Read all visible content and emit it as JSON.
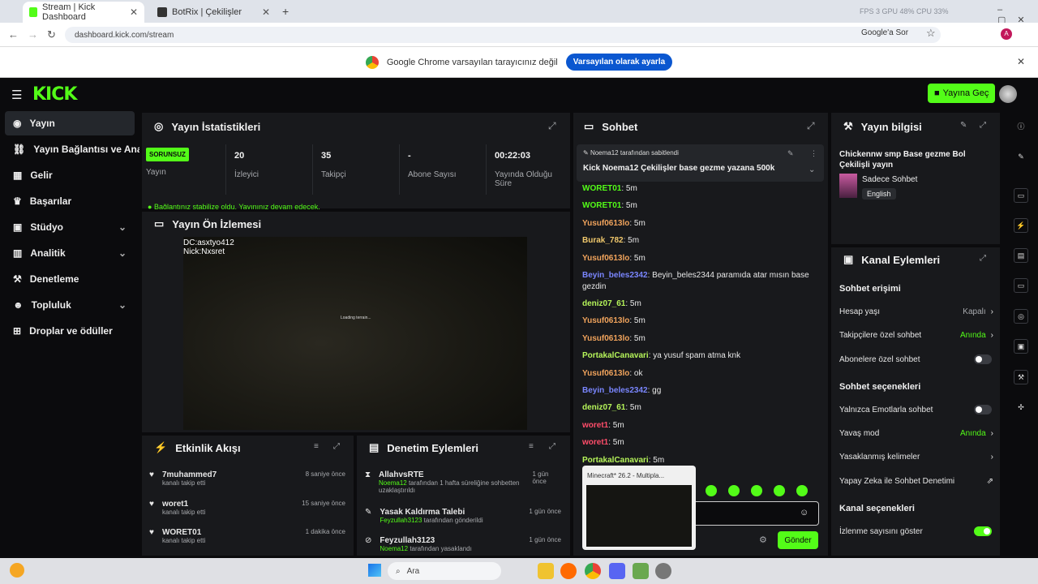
{
  "browser": {
    "tabs": [
      {
        "label": "Stream | Kick Dashboard"
      },
      {
        "label": "BotRix | Çekilişler"
      }
    ],
    "sysinfo": "FPS 3   GPU 48%   CPU 33%",
    "url": "dashboard.kick.com/stream",
    "google_lens_label": "Google'a Sor",
    "default_browser_msg": "Google Chrome varsayılan tarayıcınız değil",
    "default_browser_btn": "Varsayılan olarak ayarla"
  },
  "kick": {
    "logo": "KICK",
    "golive": "Yayına Geç"
  },
  "sidebar": {
    "items": [
      {
        "label": "Yayın",
        "icon": "broadcast-icon"
      },
      {
        "label": "Yayın Bağlantısı ve Anahtarı",
        "icon": "link-icon"
      },
      {
        "label": "Gelir",
        "icon": "money-icon"
      },
      {
        "label": "Başarılar",
        "icon": "trophy-icon"
      },
      {
        "label": "Stüdyo",
        "icon": "studio-icon"
      },
      {
        "label": "Analitik",
        "icon": "chart-icon"
      },
      {
        "label": "Denetleme",
        "icon": "hammer-icon"
      },
      {
        "label": "Topluluk",
        "icon": "community-icon"
      },
      {
        "label": "Droplar ve ödüller",
        "icon": "gift-icon"
      }
    ]
  },
  "stats": {
    "title": "Yayın İstatistikleri",
    "status_badge": "SORUNSUZ",
    "status_label": "Yayın",
    "cells": [
      {
        "value": "20",
        "label": "İzleyici"
      },
      {
        "value": "35",
        "label": "Takipçi"
      },
      {
        "value": "-",
        "label": "Abone Sayısı"
      },
      {
        "value": "00:22:03",
        "label": "Yayında Olduğu Süre"
      }
    ],
    "notice": "Bağlantınız stabilize oldu. Yayınınız devam edecek."
  },
  "preview": {
    "title": "Yayın Ön İzlemesi",
    "overlay_line1": "DC:asxtyo412",
    "overlay_line2": "Nick:Nxsret",
    "loading": "Loading terrain..."
  },
  "activity": {
    "title": "Etkinlik Akışı",
    "items": [
      {
        "user": "7muhammed7",
        "action": "kanalı takip etti",
        "time": "8 saniye önce"
      },
      {
        "user": "woret1",
        "action": "kanalı takip etti",
        "time": "15 saniye önce"
      },
      {
        "user": "WORET01",
        "action": "kanalı takip etti",
        "time": "1 dakika önce"
      }
    ]
  },
  "moderation": {
    "title": "Denetim Eylemleri",
    "items": [
      {
        "title": "AllahvsRTE",
        "by": "Noema12",
        "detail": "tarafından 1 hafta süreliğine sohbetten uzaklaştırıldı",
        "time": "1 gün önce"
      },
      {
        "title": "Yasak Kaldırma Talebi",
        "by": "Feyzullah3123",
        "detail": "tarafından gönderildi",
        "time": "1 gün önce"
      },
      {
        "title": "Feyzullah3123",
        "by": "Noema12",
        "detail": "tarafından yasaklandı",
        "time": "1 gün önce"
      }
    ]
  },
  "chat": {
    "title": "Sohbet",
    "pinned_by": "Noema12 tarafından sabitlendi",
    "pinned_msg": "Kick Noema12 Çekilişler base gezme yazana 500k",
    "messages": [
      {
        "user": "WORET01",
        "text": ": 5m",
        "color": "#53fc18"
      },
      {
        "user": "WORET01",
        "text": ": 5m",
        "color": "#53fc18"
      },
      {
        "user": "Yusuf0613lo",
        "text": ": 5m",
        "color": "#f0a35c"
      },
      {
        "user": "Burak_782",
        "text": ": 5m",
        "color": "#f0c86c"
      },
      {
        "user": "Yusuf0613lo",
        "text": ": 5m",
        "color": "#f0a35c"
      },
      {
        "user": "Beyin_beles2342",
        "text": ": Beyin_beles2344 paramıda atar mısın base gezdin",
        "color": "#7a86ff"
      },
      {
        "user": "deniz07_61",
        "text": ": 5m",
        "color": "#b6f55a"
      },
      {
        "user": "Yusuf0613lo",
        "text": ": 5m",
        "color": "#f0a35c"
      },
      {
        "user": "Yusuf0613lo",
        "text": ": 5m",
        "color": "#f0a35c"
      },
      {
        "user": "PortakalCanavari",
        "text": ": ya yusuf spam atma knk",
        "color": "#b6f55a"
      },
      {
        "user": "Yusuf0613lo",
        "text": ": ok",
        "color": "#f0a35c"
      },
      {
        "user": "Beyin_beles2342",
        "text": ": gg",
        "color": "#7a86ff"
      },
      {
        "user": "deniz07_61",
        "text": ": 5m",
        "color": "#b6f55a"
      },
      {
        "user": "woret1",
        "text": ": 5m",
        "color": "#ff4d6a"
      },
      {
        "user": "woret1",
        "text": ": 5m",
        "color": "#ff4d6a"
      },
      {
        "user": "PortakalCanavari",
        "text": ": 5m",
        "color": "#b6f55a"
      }
    ],
    "send": "Gönder",
    "thumbnail_title": "Minecraft* 26.2 - Multipla..."
  },
  "info": {
    "title": "Yayın bilgisi",
    "stream_title": "Chickennw smp Base gezme Bol Çekilişli yayın",
    "category": "Sadece Sohbet",
    "language": "English"
  },
  "channel_actions": {
    "title": "Kanal Eylemleri",
    "chat_access": "Sohbet erişimi",
    "account_age": "Hesap yaşı",
    "account_age_val": "Kapalı",
    "followers_only": "Takipçilere özel sohbet",
    "followers_only_val": "Anında",
    "subs_only": "Abonelere özel sohbet",
    "chat_options": "Sohbet seçenekleri",
    "emotes_only": "Yalnızca Emotlarla sohbet",
    "slow_mode": "Yavaş mod",
    "slow_mode_val": "Anında",
    "banned_words": "Yasaklanmış kelimeler",
    "ai_moderation": "Yapay Zeka ile Sohbet Denetimi",
    "channel_options": "Kanal seçenekleri",
    "show_viewers": "İzlenme sayısını göster"
  },
  "taskbar": {
    "search": "Ara"
  },
  "colors": {
    "accent": "#53fc18",
    "bg": "#0b0b0d",
    "panel": "#18191c"
  }
}
